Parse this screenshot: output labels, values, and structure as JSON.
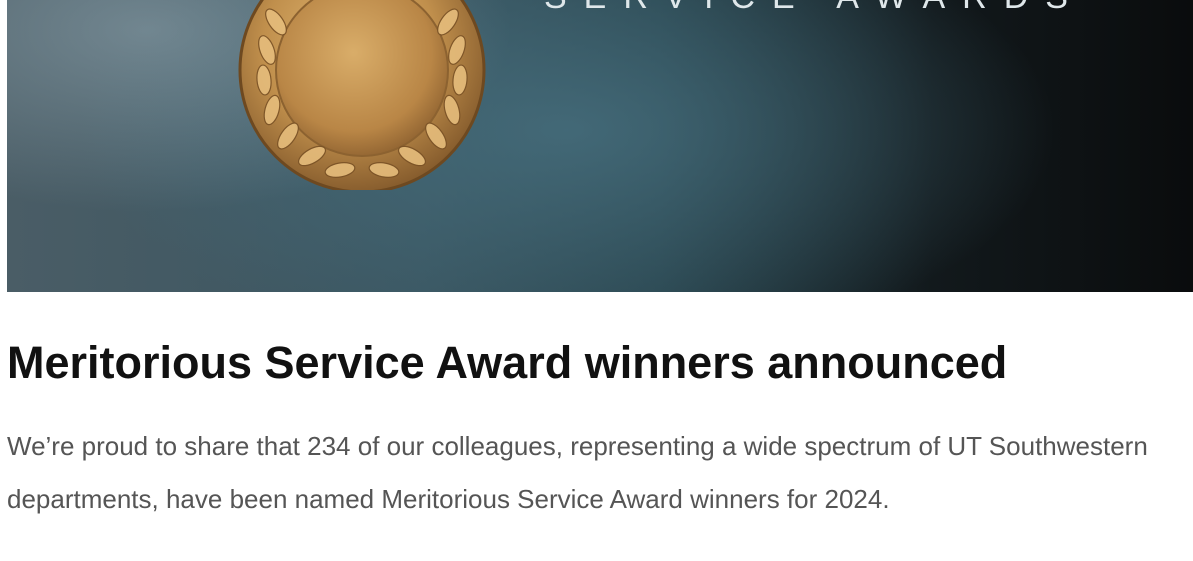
{
  "hero": {
    "banner_text": "SERVICE AWARDS",
    "medal_icon": "laurel-medal-icon",
    "colors": {
      "medal_gold": "#b88a45",
      "banner_dark": "#0a0c0d",
      "banner_teal": "#3a5560"
    }
  },
  "article": {
    "title": "Meritorious Service Award winners announced",
    "summary": "We’re proud to share that 234 of our colleagues, representing a wide spectrum of UT Southwestern departments, have been named Meritorious Service Award winners for 2024."
  }
}
